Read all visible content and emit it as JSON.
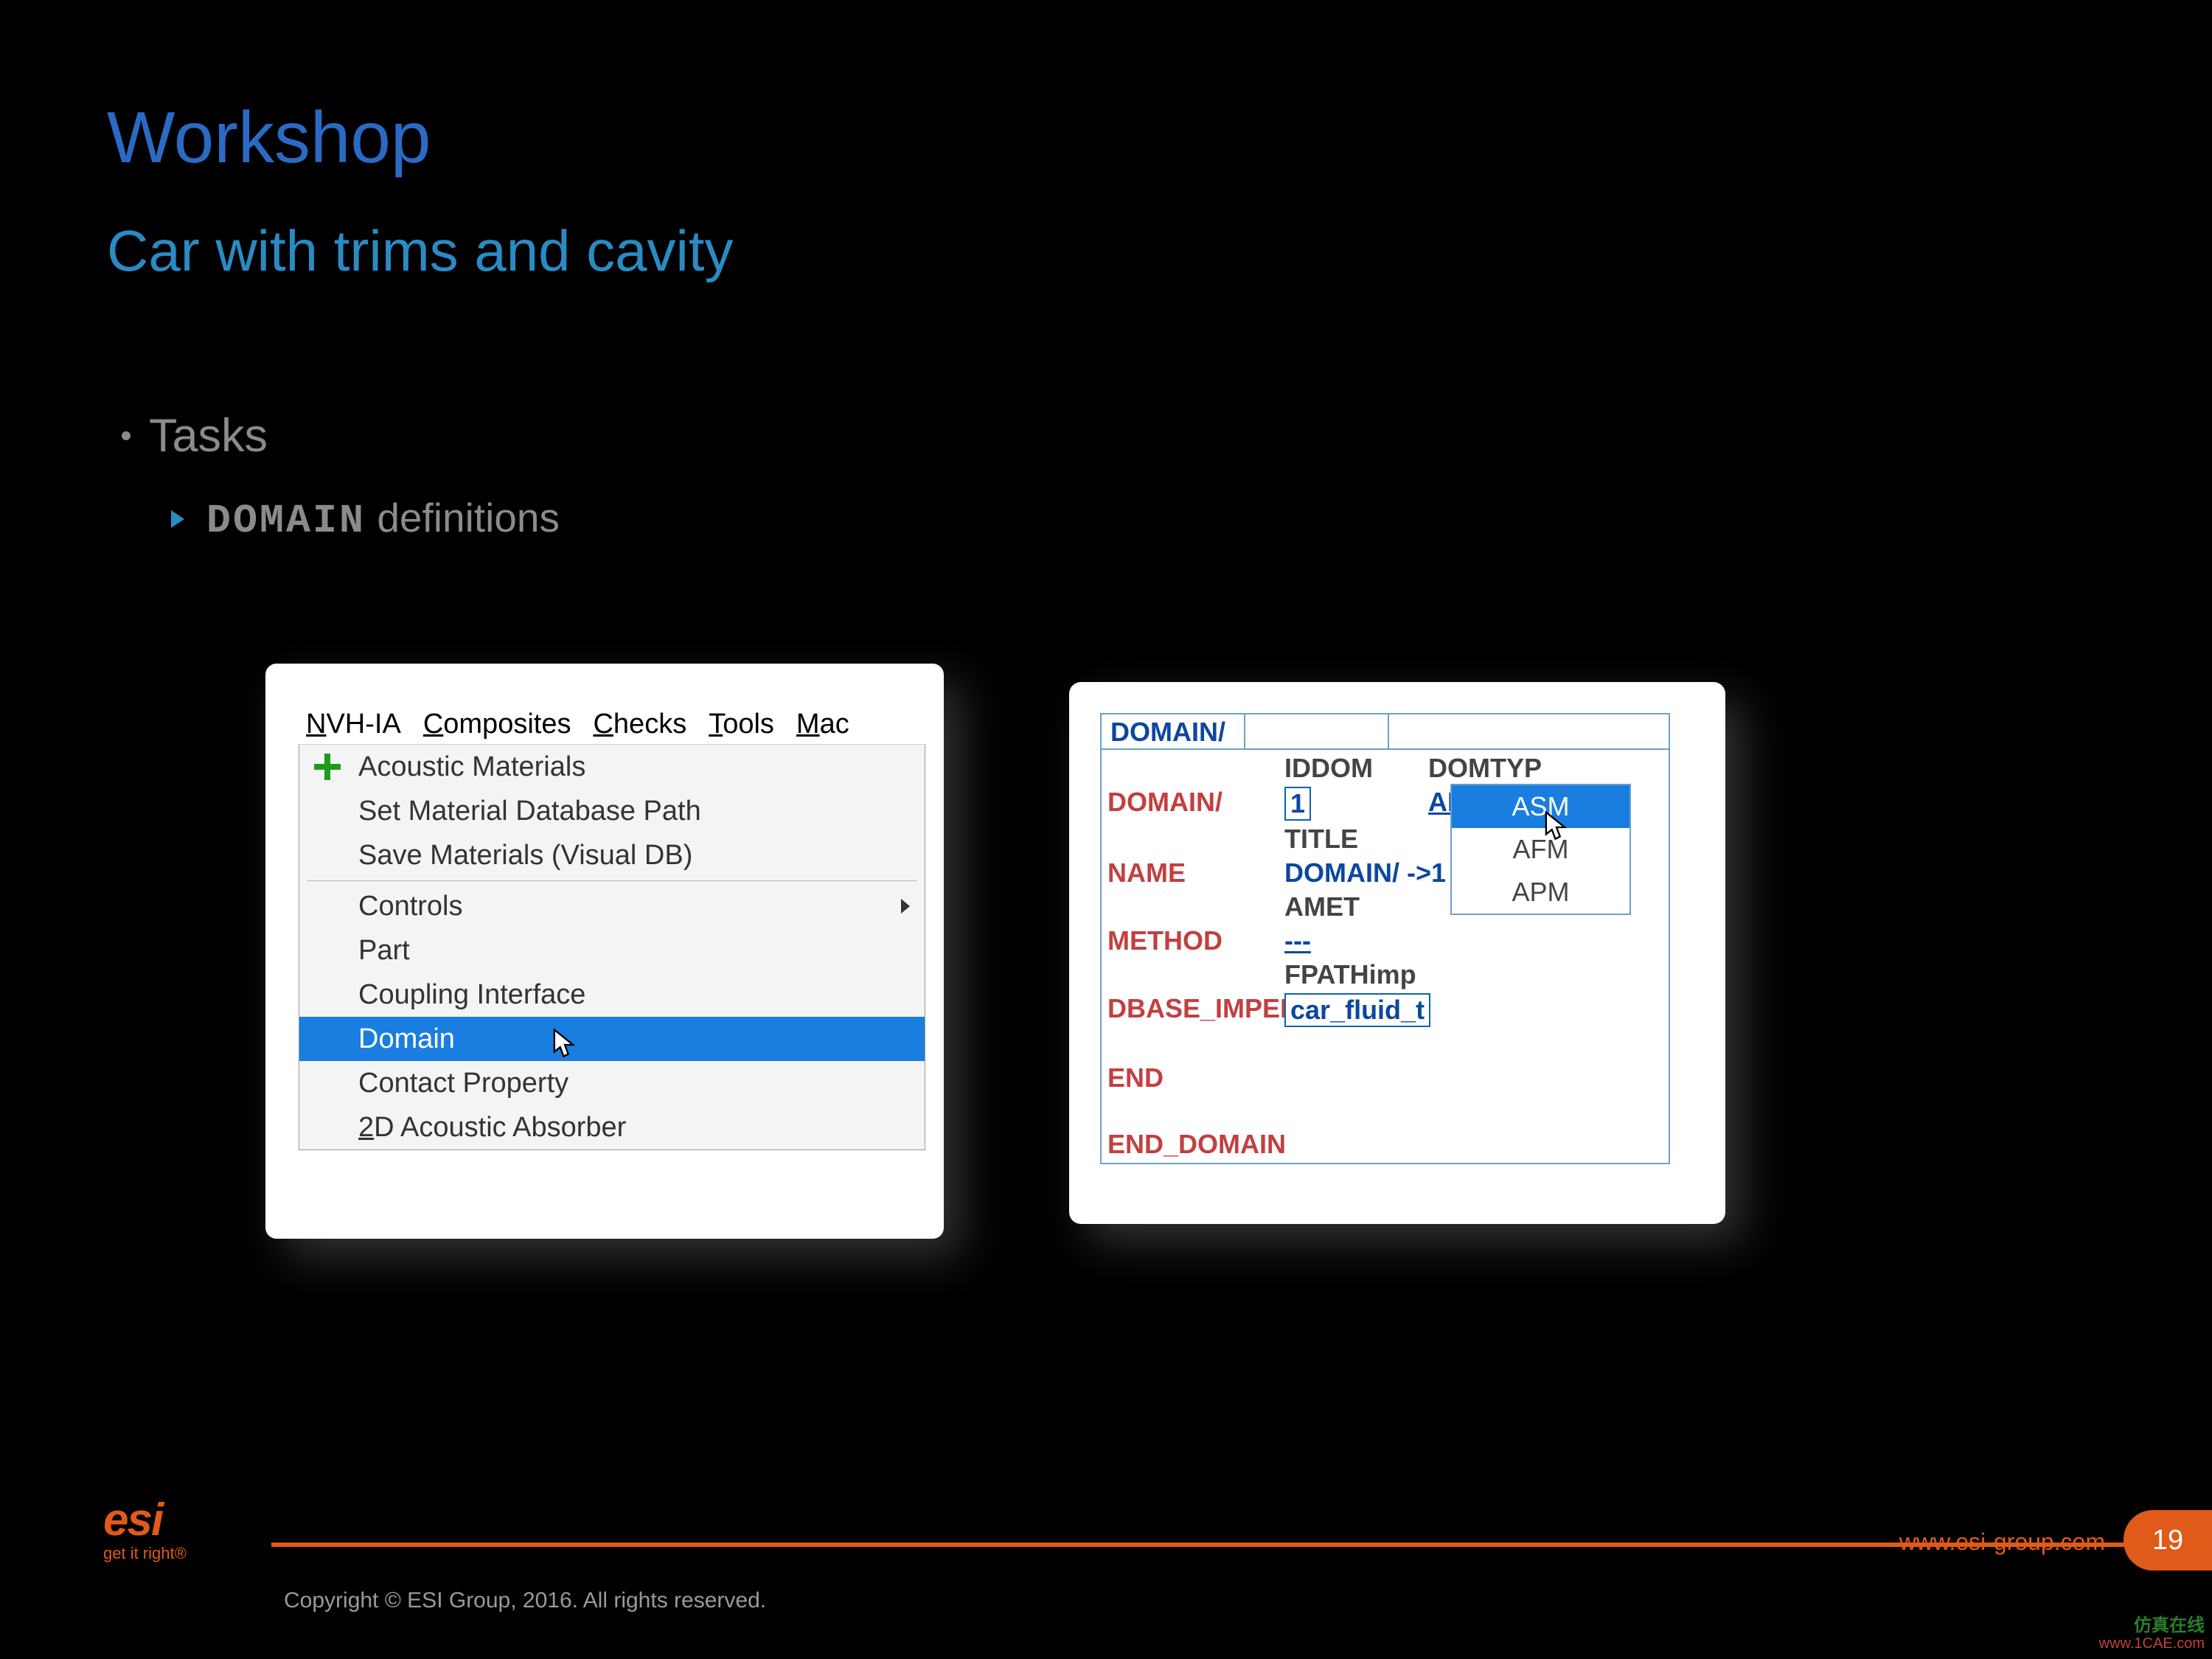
{
  "title": "Workshop",
  "subtitle": "Car with trims and cavity",
  "bullet1": "Tasks",
  "bullet2_kw": "DOMAIN",
  "bullet2_rest": "  definitions",
  "menubar": [
    "NVH-IA",
    "Composites",
    "Checks",
    "Tools",
    "Mac"
  ],
  "menu": {
    "acousticMaterials": "Acoustic Materials",
    "setDbPath": "Set Material Database Path",
    "saveVisualDb": "Save Materials (Visual DB)",
    "controls": "Controls",
    "part": "Part",
    "coupling": "Coupling Interface",
    "domain": "Domain",
    "contactProp": "Contact Property",
    "absorber2d": "2D Acoustic Absorber"
  },
  "panel2": {
    "headerTab": "DOMAIN/",
    "row_iddom": "IDDOM",
    "row_domtyp": "DOMTYP",
    "lab_domain": "DOMAIN/",
    "val_iddom": "1",
    "val_domtyp": "APM",
    "row_title": "TITLE",
    "lab_name": "NAME",
    "val_name": "DOMAIN/ ->1",
    "row_amet": "AMET",
    "lab_method": "METHOD",
    "val_method": "---",
    "row_fpath": "FPATHimp",
    "lab_dbase": "DBASE_IMPED/",
    "val_dbase": "car_fluid_t",
    "lab_end": "END",
    "lab_enddomain": "END_DOMAIN",
    "dd": {
      "asm": "ASM",
      "afm": "AFM",
      "apm": "APM"
    }
  },
  "footer": {
    "copyright": "Copyright © ESI Group, 2016. All rights reserved.",
    "site": "www.esi-group.com",
    "page": "19",
    "logo_main": "esi",
    "logo_tag": "get it right®",
    "watermark1": "仿真在线",
    "watermark2": "www.1CAE.com"
  }
}
